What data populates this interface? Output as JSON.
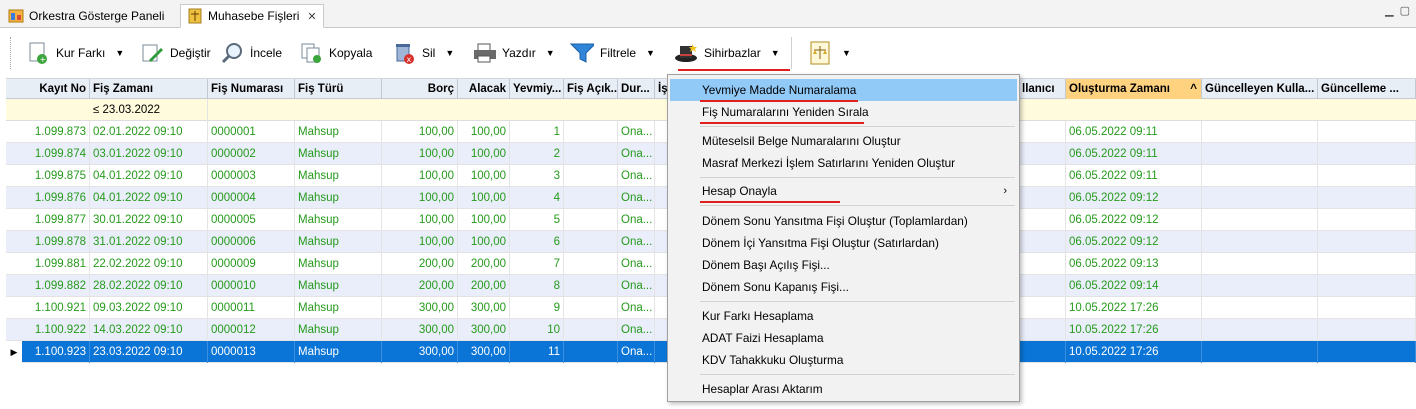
{
  "tabs": [
    {
      "label": "Orkestra Gösterge Paneli",
      "active": false
    },
    {
      "label": "Muhasebe Fişleri",
      "active": true
    }
  ],
  "toolbar": {
    "kur_farki": "Kur Farkı",
    "degistir": "Değiştir",
    "incele": "İncele",
    "kopyala": "Kopyala",
    "sil": "Sil",
    "yazdir": "Yazdır",
    "filtrele": "Filtrele",
    "sihirbazlar": "Sihirbazlar"
  },
  "columns": [
    "Kayıt No",
    "Fiş Zamanı",
    "Fiş Numarası",
    "Fiş Türü",
    "Borç",
    "Alacak",
    "Yevmiy...",
    "Fiş Açık...",
    "Dur...",
    "İş",
    "llanıcı",
    "Oluşturma Zamanı",
    "Güncelleyen Kulla...",
    "Güncelleme ..."
  ],
  "filter": {
    "fis_zamani": "≤ 23.03.2022"
  },
  "rows": [
    [
      "1.099.873",
      "02.01.2022 09:10",
      "0000001",
      "Mahsup",
      "100,00",
      "100,00",
      "1",
      "",
      "Ona...",
      "06.05.2022 09:11"
    ],
    [
      "1.099.874",
      "03.01.2022 09:10",
      "0000002",
      "Mahsup",
      "100,00",
      "100,00",
      "2",
      "",
      "Ona...",
      "06.05.2022 09:11"
    ],
    [
      "1.099.875",
      "04.01.2022 09:10",
      "0000003",
      "Mahsup",
      "100,00",
      "100,00",
      "3",
      "",
      "Ona...",
      "06.05.2022 09:11"
    ],
    [
      "1.099.876",
      "04.01.2022 09:10",
      "0000004",
      "Mahsup",
      "100,00",
      "100,00",
      "4",
      "",
      "Ona...",
      "06.05.2022 09:12"
    ],
    [
      "1.099.877",
      "30.01.2022 09:10",
      "0000005",
      "Mahsup",
      "100,00",
      "100,00",
      "5",
      "",
      "Ona...",
      "06.05.2022 09:12"
    ],
    [
      "1.099.878",
      "31.01.2022 09:10",
      "0000006",
      "Mahsup",
      "100,00",
      "100,00",
      "6",
      "",
      "Ona...",
      "06.05.2022 09:12"
    ],
    [
      "1.099.881",
      "22.02.2022 09:10",
      "0000009",
      "Mahsup",
      "200,00",
      "200,00",
      "7",
      "",
      "Ona...",
      "06.05.2022 09:13"
    ],
    [
      "1.099.882",
      "28.02.2022 09:10",
      "0000010",
      "Mahsup",
      "200,00",
      "200,00",
      "8",
      "",
      "Ona...",
      "06.05.2022 09:14"
    ],
    [
      "1.100.921",
      "09.03.2022 09:10",
      "0000011",
      "Mahsup",
      "300,00",
      "300,00",
      "9",
      "",
      "Ona...",
      "10.05.2022 17:26"
    ],
    [
      "1.100.922",
      "14.03.2022 09:10",
      "0000012",
      "Mahsup",
      "300,00",
      "300,00",
      "10",
      "",
      "Ona...",
      "10.05.2022 17:26"
    ],
    [
      "1.100.923",
      "23.03.2022 09:10",
      "0000013",
      "Mahsup",
      "300,00",
      "300,00",
      "11",
      "",
      "Ona...",
      "10.05.2022 17:26"
    ]
  ],
  "menu": [
    "Yevmiye Madde Numaralama",
    "Fiş Numaralarını Yeniden Sırala",
    "Müteselsil Belge Numaralarını Oluştur",
    "Masraf Merkezi İşlem Satırlarını Yeniden Oluştur",
    "Hesap Onayla",
    "Dönem Sonu Yansıtma Fişi Oluştur (Toplamlardan)",
    "Dönem İçi Yansıtma Fişi Oluştur (Satırlardan)",
    "Dönem Başı Açılış Fişi...",
    "Dönem Sonu Kapanış Fişi...",
    "Kur Farkı Hesaplama",
    "ADAT Faizi Hesaplama",
    "KDV Tahakkuku Oluşturma",
    "Hesaplar Arası Aktarım"
  ],
  "colors": {
    "selected_row": "#0a75d6",
    "highlight_menu": "#91c9f7",
    "annotation_red": "#e0201c",
    "green_text": "#249a1a"
  }
}
